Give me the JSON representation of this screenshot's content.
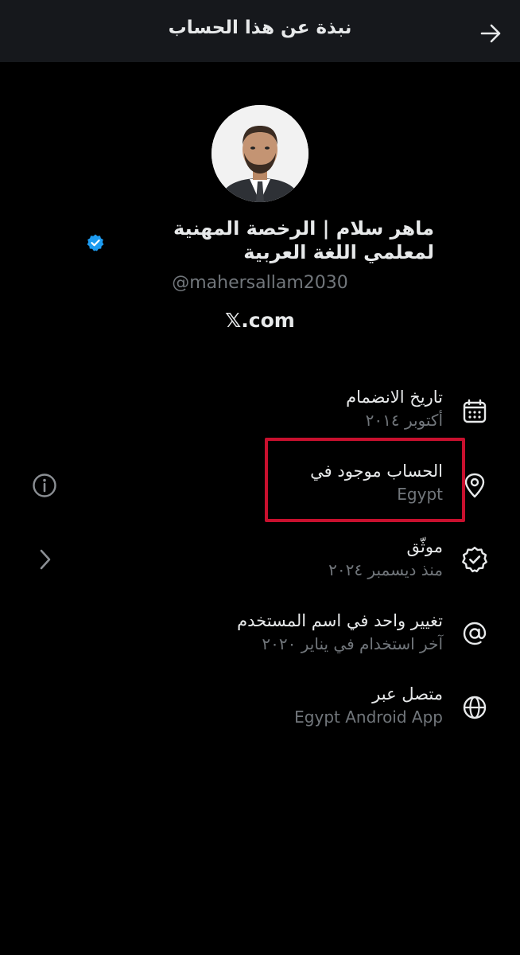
{
  "header": {
    "title": "نبذة عن هذا الحساب",
    "back_icon": "arrow-right-icon"
  },
  "profile": {
    "display_name": "ماهر سلام | الرخصة المهنية لمعلمي اللغة العربية",
    "verified": true,
    "verified_color": "#1d9bf0",
    "handle": "@mahersallam2030",
    "platform": "𝕏.com"
  },
  "details": [
    {
      "icon": "calendar-icon",
      "label": "تاريخ الانضمام",
      "value": "أكتوبر ٢٠١٤"
    },
    {
      "icon": "location-pin-icon",
      "label": "الحساب موجود في",
      "value": "Egypt"
    },
    {
      "icon": "verified-badge-icon",
      "label": "موثّق",
      "value": "منذ ديسمبر ٢٠٢٤"
    },
    {
      "icon": "at-sign-icon",
      "label": "تغيير واحد في اسم المستخدم",
      "value": "آخر استخدام في يناير ٢٠٢٠"
    },
    {
      "icon": "globe-icon",
      "label": "متصل عبر",
      "value": "Egypt Android App"
    }
  ],
  "annotation": {
    "highlight_color": "#c8102e"
  },
  "side_controls": {
    "info_icon": "info-icon",
    "chevron_icon": "chevron-right-icon"
  }
}
